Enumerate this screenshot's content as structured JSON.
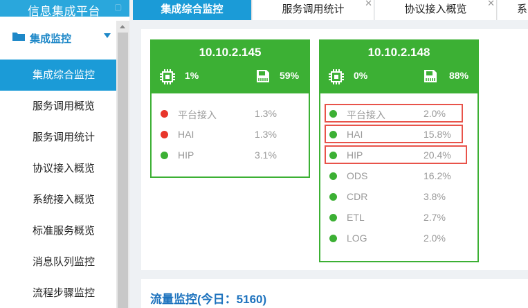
{
  "sidebar": {
    "title": "信息集成平台",
    "group_label": "集成监控",
    "items": [
      {
        "label": "集成综合监控",
        "active": true
      },
      {
        "label": "服务调用概览"
      },
      {
        "label": "服务调用统计"
      },
      {
        "label": "协议接入概览"
      },
      {
        "label": "系统接入概览"
      },
      {
        "label": "标准服务概览"
      },
      {
        "label": "消息队列监控"
      },
      {
        "label": "流程步骤监控"
      }
    ]
  },
  "tabs": [
    {
      "label": "集成综合监控",
      "active": true
    },
    {
      "label": "服务调用统计"
    },
    {
      "label": "协议接入概览"
    },
    {
      "label": "系"
    }
  ],
  "cards": [
    {
      "ip": "10.10.2.145",
      "cpu": "1%",
      "memory": "59%",
      "rows": [
        {
          "name": "平台接入",
          "value": "1.3%",
          "status": "red"
        },
        {
          "name": "HAI",
          "value": "1.3%",
          "status": "red"
        },
        {
          "name": "HIP",
          "value": "3.1%",
          "status": "green"
        }
      ]
    },
    {
      "ip": "10.10.2.148",
      "cpu": "0%",
      "memory": "88%",
      "rows": [
        {
          "name": "平台接入",
          "value": "2.0%",
          "status": "green"
        },
        {
          "name": "HAI",
          "value": "15.8%",
          "status": "green"
        },
        {
          "name": "HIP",
          "value": "20.4%",
          "status": "green"
        },
        {
          "name": "ODS",
          "value": "16.2%",
          "status": "green"
        },
        {
          "name": "CDR",
          "value": "3.8%",
          "status": "green"
        },
        {
          "name": "ETL",
          "value": "2.7%",
          "status": "green"
        },
        {
          "name": "LOG",
          "value": "2.0%",
          "status": "green"
        }
      ]
    }
  ],
  "flow": {
    "title": "流量监控(今日：5160)"
  },
  "colors": {
    "accent": "#1b9bd7",
    "green": "#3cb034",
    "red": "#e8362b",
    "highlight": "#e8534a"
  }
}
